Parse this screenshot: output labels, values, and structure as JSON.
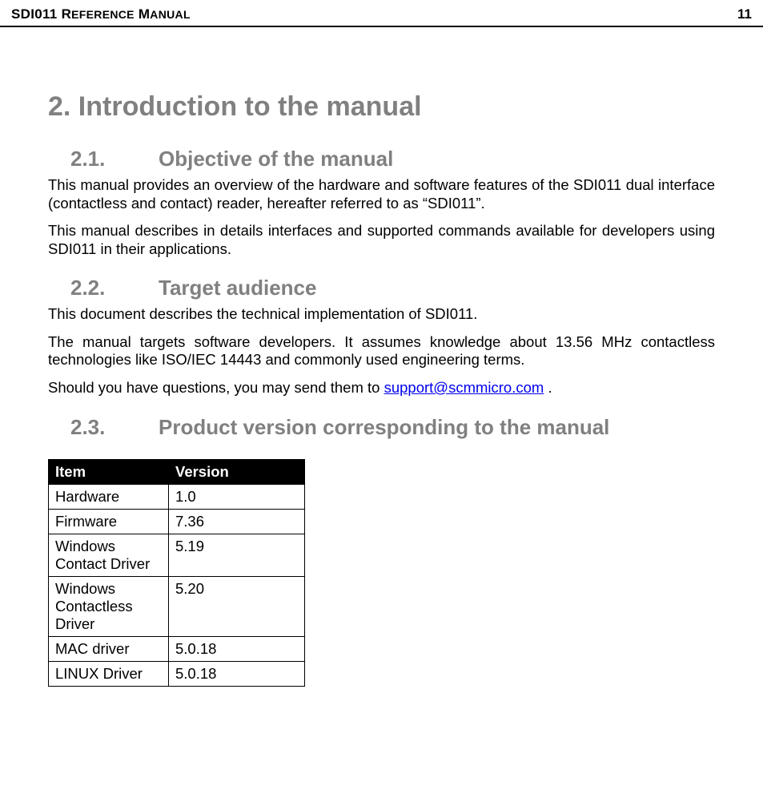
{
  "header": {
    "title_caps": "SDI011 R",
    "title_rest_1": "EFERENCE",
    "title_caps_2": " M",
    "title_rest_2": "ANUAL",
    "page": "11"
  },
  "h1": "2. Introduction to the manual",
  "s21": {
    "num": "2.1.",
    "title": "Objective of the manual",
    "p1": "This manual provides an overview of the hardware and software features of the SDI011 dual interface (contactless and contact) reader, hereafter referred to as “SDI011”.",
    "p2": "This manual describes in details interfaces and supported commands available for developers using SDI011 in their applications."
  },
  "s22": {
    "num": "2.2.",
    "title": "Target audience",
    "p1": "This document describes the technical implementation of SDI011.",
    "p2": "The manual targets software developers. It assumes knowledge about 13.56 MHz contactless technologies like ISO/IEC 14443 and commonly used engineering terms.",
    "p3a": "Should you have questions, you may send them to ",
    "link": "support@scmmicro.com",
    "p3b": " ."
  },
  "s23": {
    "num": "2.3.",
    "title": "Product version corresponding to the manual"
  },
  "table": {
    "head_item": "Item",
    "head_version": "Version",
    "rows": [
      {
        "item": "Hardware",
        "version": "1.0"
      },
      {
        "item": "Firmware",
        "version": "7.36"
      },
      {
        "item": "Windows Contact Driver",
        "version": "5.19"
      },
      {
        "item": "Windows Contactless Driver",
        "version": "5.20"
      },
      {
        "item": "MAC driver",
        "version": "5.0.18"
      },
      {
        "item": "LINUX Driver",
        "version": "5.0.18"
      }
    ]
  }
}
